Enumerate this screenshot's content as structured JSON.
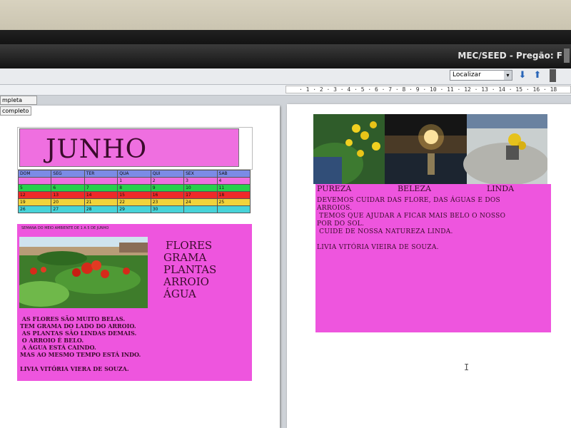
{
  "window": {
    "title": "MEC/SEED - Pregão: F"
  },
  "toolbar": {
    "find_placeholder": "Localizar",
    "find_down_icon": "arrow-down-icon",
    "find_up_icon": "arrow-up-icon"
  },
  "ruler": {
    "ticks": "· 1 · 2 · 3 · 4 · 5 · 6 · 7 · 8 · 9 · 10 · 11 · 12 · 13 · 14 · 15 · 16 · 18"
  },
  "zoom_panel": {
    "option_1": "mpleta",
    "option_2": "completo"
  },
  "left_page": {
    "month": "JUNHO",
    "calendar": {
      "header": [
        "DOM",
        "SEG",
        "TER",
        "QUA",
        "QUI",
        "SEX",
        "SAB"
      ],
      "rows": [
        [
          "",
          "",
          "",
          "1",
          "2",
          "3",
          "4"
        ],
        [
          "5",
          "6",
          "7",
          "8",
          "9",
          "10",
          "11"
        ],
        [
          "12",
          "13",
          "14",
          "15",
          "16",
          "17",
          "18"
        ],
        [
          "19",
          "20",
          "21",
          "22",
          "23",
          "24",
          "25"
        ],
        [
          "26",
          "27",
          "28",
          "29",
          "30",
          "",
          ""
        ]
      ],
      "row_colors": [
        "#ef6fe0",
        "#27d04d",
        "#ee2a2a",
        "#f1d33b",
        "#47d3d8"
      ],
      "header_color": "#7b8be6"
    },
    "caption": "SEMANA DO MEIO AMBIENTE DE 1 A 5 DE JUNHO",
    "words": [
      "FLORES",
      "GRAMA",
      "PLANTAS",
      "ARROIO",
      "ÁGUA"
    ],
    "text": " AS FLORES SÃO MUITO BELAS.\nTEM GRAMA DO LADO DO ARROIO.\n AS PLANTAS SÃO LINDAS DEMAIS.\n O ARROIO É BELO.\n A ÁGUA ESTÁ CAINDO.\nMAS AO MESMO TEMPO ESTÁ INDO.\n\nLIVIA VITÓRIA VIERA DE SOUZA."
  },
  "right_page": {
    "labels": [
      "PUREZA",
      "BELEZA",
      "LINDA"
    ],
    "text": "DEVEMOS CUIDAR DAS FLORE, DAS ÁGUAS E DOS\nARROIOS.\n TEMOS QUE AJUDAR A FICAR MAIS BELO O NOSSO\nPOR DO SOL.\n CUIDE DE NOSSA NATUREZA LINDA.\n\nLIVIA VITÓRIA VIEIRA DE SOUZA."
  },
  "colors": {
    "pink": "#ee55de",
    "title_purple": "#3b0b2c"
  }
}
